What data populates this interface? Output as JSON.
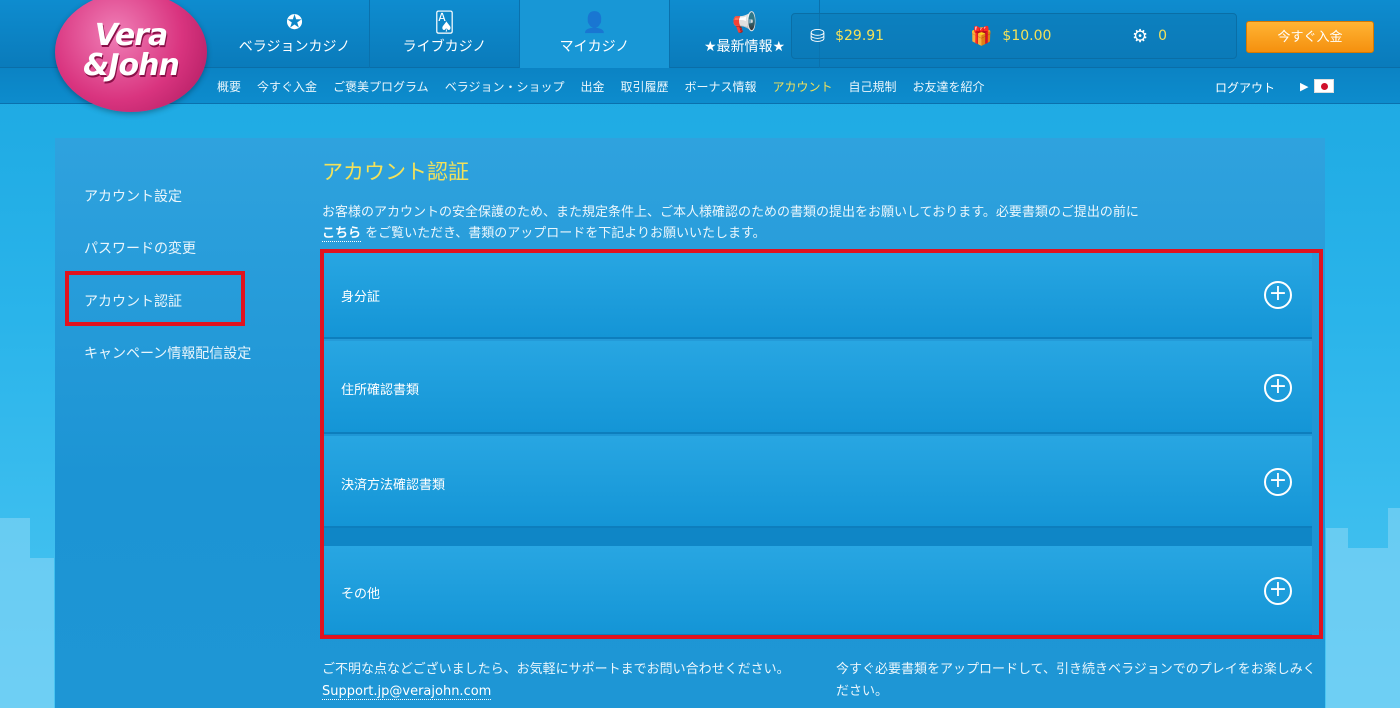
{
  "brand": {
    "logo_line1": "Vera",
    "logo_line2": "&John"
  },
  "main_nav": [
    {
      "label": "ベラジョンカジノ",
      "icon": "chip-icon"
    },
    {
      "label": "ライブカジノ",
      "icon": "cards-icon"
    },
    {
      "label": "マイカジノ",
      "icon": "user-icon"
    },
    {
      "label": "★最新情報★",
      "icon": "megaphone-icon"
    }
  ],
  "wallet": {
    "cash": "$29.91",
    "bonus": "$10.00",
    "spins": "0"
  },
  "deposit_button": "今すぐ入金",
  "sub_nav": [
    "概要",
    "今すぐ入金",
    "ご褒美プログラム",
    "ベラジョン・ショップ",
    "出金",
    "取引履歴",
    "ボーナス情報",
    "アカウント",
    "自己規制",
    "お友達を紹介"
  ],
  "logout": "ログアウト",
  "sidebar": [
    "アカウント設定",
    "パスワードの変更",
    "アカウント認証",
    "キャンペーン情報配信設定"
  ],
  "page_title": "アカウント認証",
  "intro": {
    "text1": "お客様のアカウントの安全保護のため、また規定条件上、ご本人様確認のための書類の提出をお願いしております。必要書類のご提出の前に",
    "link": "こちら",
    "text2": " をご覧いただき、書類のアップロードを下記よりお願いいたします。"
  },
  "documents": [
    "身分証",
    "住所確認書類",
    "決済方法確認書類",
    "その他"
  ],
  "footer": {
    "left_text": "ご不明な点などございましたら、お気軽にサポートまでお問い合わせください。",
    "email": "Support.jp@verajohn.com",
    "right_text": "今すぐ必要書類をアップロードして、引き続きベラジョンでのプレイをお楽しみください。"
  },
  "colors": {
    "accent_yellow": "#f3e15a",
    "highlight_red": "#e1121f",
    "deposit_orange": "#f5900e"
  }
}
